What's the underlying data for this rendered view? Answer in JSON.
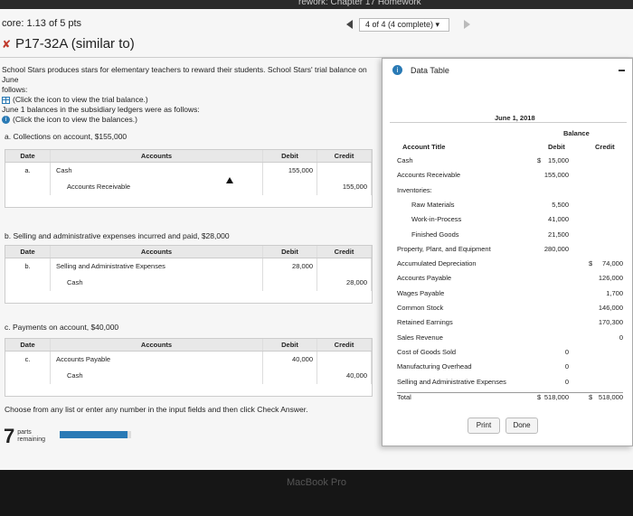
{
  "header": {
    "window_title": "rework: Chapter 17 Homework",
    "score": "core: 1.13 of 5 pts",
    "nav_status": "4 of 4 (4 complete)",
    "problem_title": "P17-32A (similar to)"
  },
  "intro": {
    "line1": "School Stars produces stars for elementary teachers to reward their students. School Stars' trial balance on June",
    "line2": "follows:",
    "link1": "(Click the icon to view the trial balance.)",
    "line3": "June 1 balances in the subsidiary ledgers were as follows:",
    "link2": "(Click the icon to view the balances.)"
  },
  "journal_headers": {
    "date": "Date",
    "accounts": "Accounts",
    "debit": "Debit",
    "credit": "Credit"
  },
  "entries": [
    {
      "label": "a. Collections on account, $155,000",
      "date": "a.",
      "debit_account": "Cash",
      "credit_account": "Accounts Receivable",
      "debit": "155,000",
      "credit": "155,000"
    },
    {
      "label": "b. Selling and administrative expenses incurred and paid, $28,000",
      "date": "b.",
      "debit_account": "Selling and Administrative Expenses",
      "credit_account": "Cash",
      "debit": "28,000",
      "credit": "28,000"
    },
    {
      "label": "c. Payments on account, $40,000",
      "date": "c.",
      "debit_account": "Accounts Payable",
      "credit_account": "Cash",
      "debit": "40,000",
      "credit": "40,000"
    }
  ],
  "footer": {
    "instruction": "Choose from any list or enter any number in the input fields and then click Check Answer.",
    "parts_count": "7",
    "parts_label_1": "parts",
    "parts_label_2": "remaining",
    "progress": 0.95
  },
  "modal": {
    "title": "Data Table",
    "date": "June 1, 2018",
    "balance_label": "Balance",
    "col_title": "Account Title",
    "col_debit": "Debit",
    "col_credit": "Credit",
    "rows": [
      {
        "name": "Cash",
        "dl": "$",
        "debit": "15,000",
        "cl": "",
        "credit": ""
      },
      {
        "name": "Accounts Receivable",
        "dl": "",
        "debit": "155,000",
        "cl": "",
        "credit": ""
      },
      {
        "name": "Inventories:",
        "dl": "",
        "debit": "",
        "cl": "",
        "credit": ""
      },
      {
        "name": "Raw Materials",
        "dl": "",
        "debit": "5,500",
        "cl": "",
        "credit": ""
      },
      {
        "name": "Work-in-Process",
        "dl": "",
        "debit": "41,000",
        "cl": "",
        "credit": ""
      },
      {
        "name": "Finished Goods",
        "dl": "",
        "debit": "21,500",
        "cl": "",
        "credit": ""
      },
      {
        "name": "Property, Plant, and Equipment",
        "dl": "",
        "debit": "280,000",
        "cl": "",
        "credit": ""
      },
      {
        "name": "Accumulated Depreciation",
        "dl": "",
        "debit": "",
        "cl": "$",
        "credit": "74,000"
      },
      {
        "name": "Accounts Payable",
        "dl": "",
        "debit": "",
        "cl": "",
        "credit": "126,000"
      },
      {
        "name": "Wages Payable",
        "dl": "",
        "debit": "",
        "cl": "",
        "credit": "1,700"
      },
      {
        "name": "Common Stock",
        "dl": "",
        "debit": "",
        "cl": "",
        "credit": "146,000"
      },
      {
        "name": "Retained Earnings",
        "dl": "",
        "debit": "",
        "cl": "",
        "credit": "170,300"
      },
      {
        "name": "Sales Revenue",
        "dl": "",
        "debit": "",
        "cl": "",
        "credit": "0"
      },
      {
        "name": "Cost of Goods Sold",
        "dl": "",
        "debit": "0",
        "cl": "",
        "credit": ""
      },
      {
        "name": "Manufacturing Overhead",
        "dl": "",
        "debit": "0",
        "cl": "",
        "credit": ""
      },
      {
        "name": "Selling and Administrative Expenses",
        "dl": "",
        "debit": "0",
        "cl": "",
        "credit": ""
      },
      {
        "name": "Total",
        "dl": "$",
        "debit": "518,000",
        "cl": "$",
        "credit": "518,000"
      }
    ],
    "print_label": "Print",
    "done_label": "Done"
  },
  "bezel_label": "MacBook Pro"
}
